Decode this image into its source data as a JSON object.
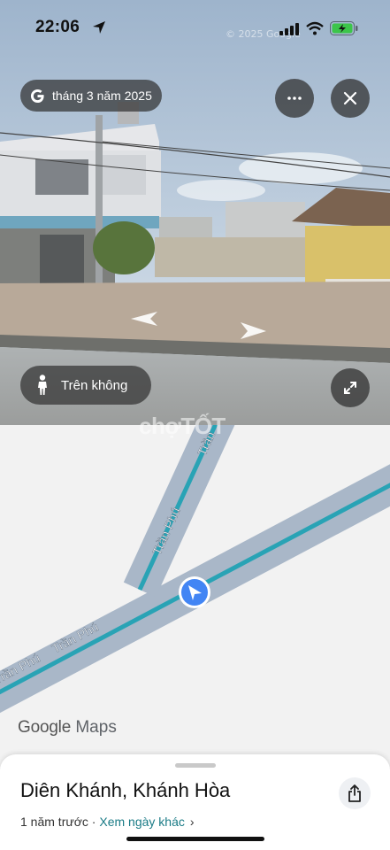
{
  "status_bar": {
    "time": "22:06",
    "battery_color": "#3cc54a"
  },
  "streetview": {
    "date_label": "tháng 3 năm 2025",
    "aerial_button_label": "Trên không",
    "watermark": "© 2025 Google",
    "icons": [
      "google-g-icon",
      "more-icon",
      "close-icon",
      "person-icon",
      "expand-icon",
      "nav-arrow-left-icon",
      "nav-arrow-right-icon"
    ]
  },
  "map": {
    "roads": [
      {
        "name": "Trần Phú"
      },
      {
        "name": "Trần Phú"
      },
      {
        "name": "Trần"
      },
      {
        "name": "Trần Phú"
      }
    ],
    "overlay_watermark": "chợTỐT",
    "logo_google": "Google",
    "logo_maps": "Maps",
    "road_color": "#a9b7c8",
    "route_color": "#29a3b5",
    "location_dot_color": "#4285f4"
  },
  "sheet": {
    "title": "Diên Khánh, Khánh Hòa",
    "time_ago": "1 năm trước",
    "separator": " · ",
    "other_dates_link": "Xem ngày khác",
    "chevron": "›"
  }
}
